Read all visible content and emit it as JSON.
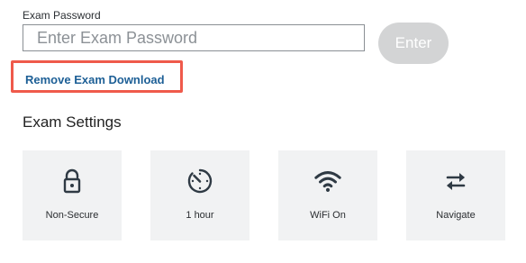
{
  "password": {
    "label": "Exam Password",
    "placeholder": "Enter Exam Password",
    "value": ""
  },
  "enter_button": {
    "label": "Enter"
  },
  "remove_download": {
    "label": "Remove Exam Download"
  },
  "settings": {
    "title": "Exam Settings",
    "tiles": [
      {
        "icon": "lock-open-icon",
        "label": "Non-Secure"
      },
      {
        "icon": "timer-icon",
        "label": "1 hour"
      },
      {
        "icon": "wifi-icon",
        "label": "WiFi On"
      },
      {
        "icon": "swap-arrows-icon",
        "label": "Navigate"
      }
    ]
  },
  "colors": {
    "link": "#1d5f96",
    "highlight_border": "#ef5a4b",
    "button_disabled": "#d3d4d5",
    "tile_bg": "#f1f2f3",
    "icon": "#2f3a44"
  }
}
